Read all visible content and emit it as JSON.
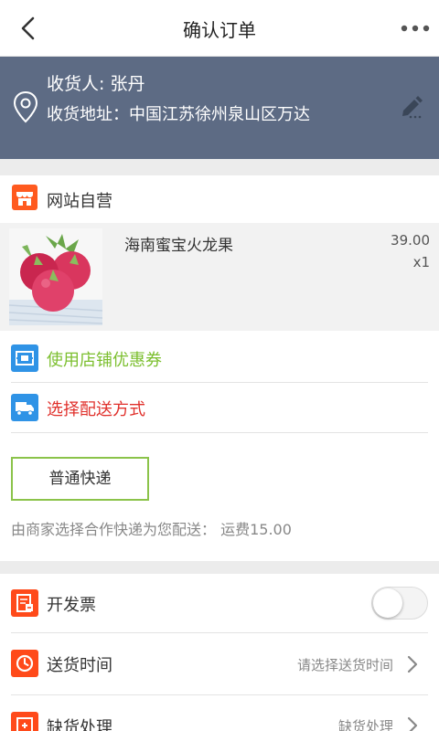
{
  "header": {
    "title": "确认订单",
    "back_icon": "chevron-left-icon",
    "more_icon": "more-horizontal-icon"
  },
  "address": {
    "receiver": "收货人: 张丹",
    "address": "收货地址：中国江苏徐州泉山区万达",
    "bg_color": "#5d6b84"
  },
  "store": {
    "name": "网站自营",
    "icon": "store-icon"
  },
  "product": {
    "name": "海南蜜宝火龙果",
    "price": "39.00",
    "quantity": "x1",
    "image": "dragon-fruit-image"
  },
  "coupon": {
    "label": "使用店铺优惠券",
    "color": "#7cbf2f"
  },
  "delivery": {
    "label": "选择配送方式",
    "color": "#e0302b",
    "option": "普通快递",
    "note": "由商家选择合作快递为您配送：  运费15.00"
  },
  "invoice": {
    "label": "开发票",
    "enabled": false
  },
  "delivery_time": {
    "label": "送货时间",
    "value": "请选择送货时间"
  },
  "stockout": {
    "label": "缺货处理",
    "value": "缺货处理"
  }
}
